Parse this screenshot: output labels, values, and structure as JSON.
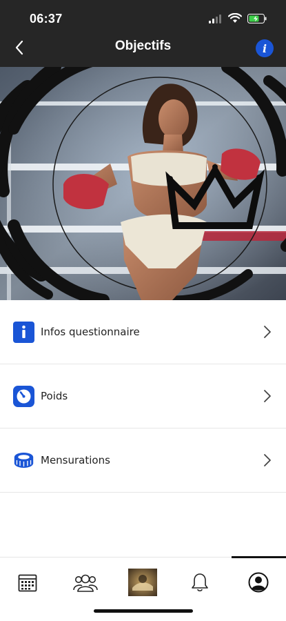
{
  "status_bar": {
    "time": "06:37",
    "battery_level": 0.6,
    "signal_bars_active": 2
  },
  "header": {
    "title": "Objectifs",
    "back_icon": "chevron-left-icon",
    "info_icon": "info-icon",
    "info_glyph": "i"
  },
  "hero": {
    "description_icon": "crown-logo-icon"
  },
  "menu": {
    "items": [
      {
        "label": "Infos questionnaire",
        "icon": "info-square-icon"
      },
      {
        "label": "Poids",
        "icon": "scale-icon"
      },
      {
        "label": "Mensurations",
        "icon": "measuring-tape-icon"
      }
    ]
  },
  "tabbar": {
    "tabs": [
      {
        "name": "calendar",
        "icon": "calendar-icon"
      },
      {
        "name": "community",
        "icon": "users-icon"
      },
      {
        "name": "home",
        "icon": "home-thumbnail"
      },
      {
        "name": "notifications",
        "icon": "bell-icon"
      },
      {
        "name": "profile",
        "icon": "profile-icon",
        "active": true
      }
    ]
  },
  "colors": {
    "accent": "#1a55d6",
    "header_bg": "#262626",
    "text": "#222222"
  }
}
